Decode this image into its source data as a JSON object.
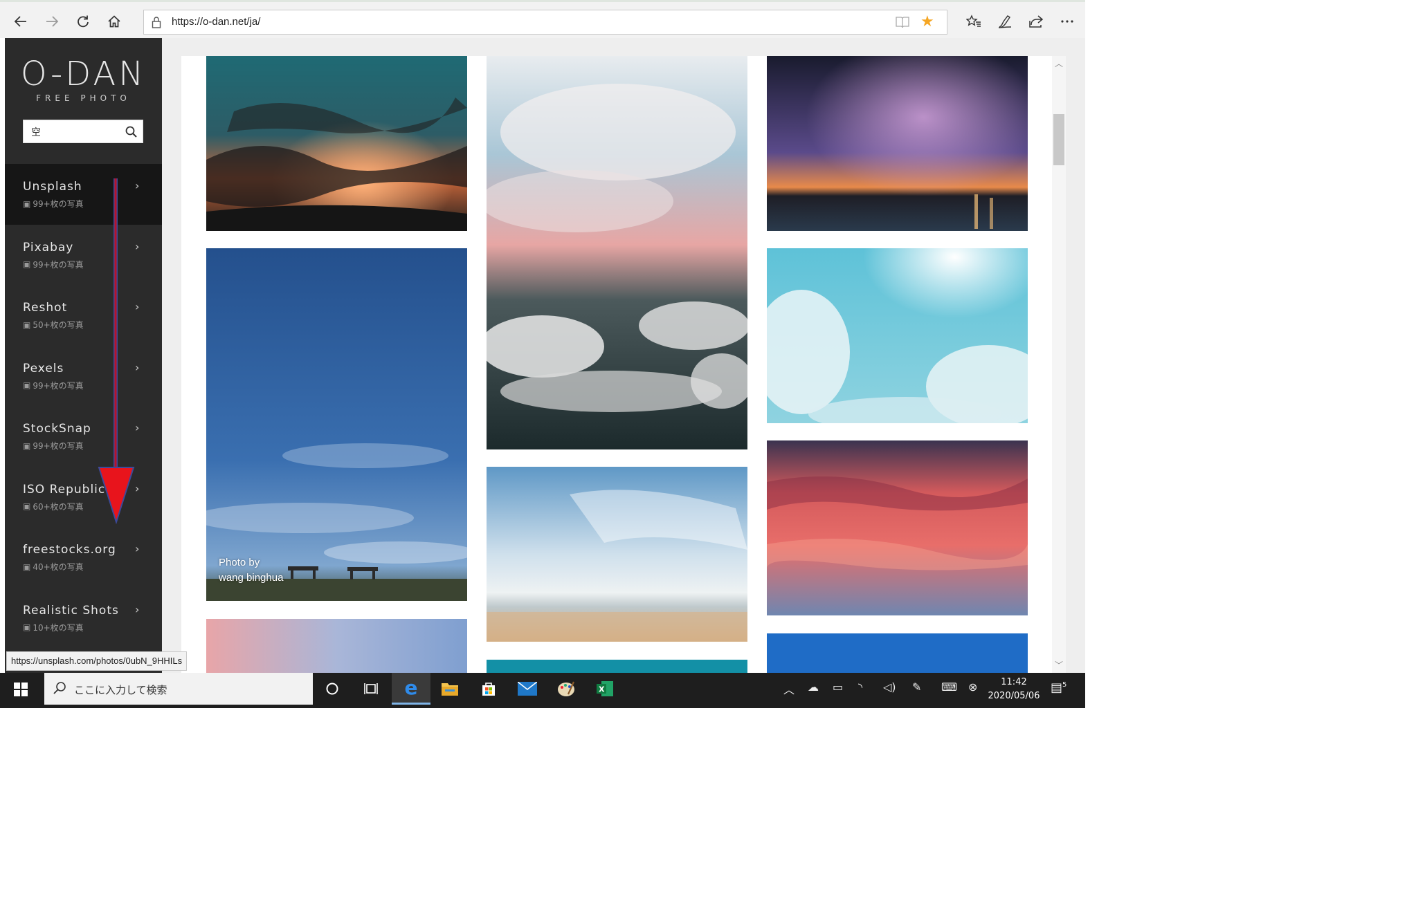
{
  "browser": {
    "url": "https://o-dan.net/ja/",
    "status_url": "https://unsplash.com/photos/0ubN_9HHILs"
  },
  "sidebar": {
    "logo_mark": "O-DAN",
    "logo_sub": "FREE PHOTO",
    "search_value": "空",
    "sources": [
      {
        "name": "Unsplash",
        "count": "99+枚の写真"
      },
      {
        "name": "Pixabay",
        "count": "99+枚の写真"
      },
      {
        "name": "Reshot",
        "count": "50+枚の写真"
      },
      {
        "name": "Pexels",
        "count": "99+枚の写真"
      },
      {
        "name": "StockSnap",
        "count": "99+枚の写真"
      },
      {
        "name": "ISO Republic",
        "count": "60+枚の写真"
      },
      {
        "name": "freestocks.org",
        "count": "40+枚の写真"
      },
      {
        "name": "Realistic Shots",
        "count": "10+枚の写真"
      }
    ]
  },
  "photos": {
    "credit_prefix": "Photo by",
    "credit_name": "wang binghua"
  },
  "taskbar": {
    "search_placeholder": "ここに入力して検索",
    "time": "11:42",
    "date": "2020/05/06",
    "notification_count": "5"
  },
  "colors": {
    "sidebar_bg": "#2b2b2b",
    "sidebar_active": "#161616",
    "favorite_star": "#f5a623",
    "annotation_arrow": "#e8141c"
  }
}
